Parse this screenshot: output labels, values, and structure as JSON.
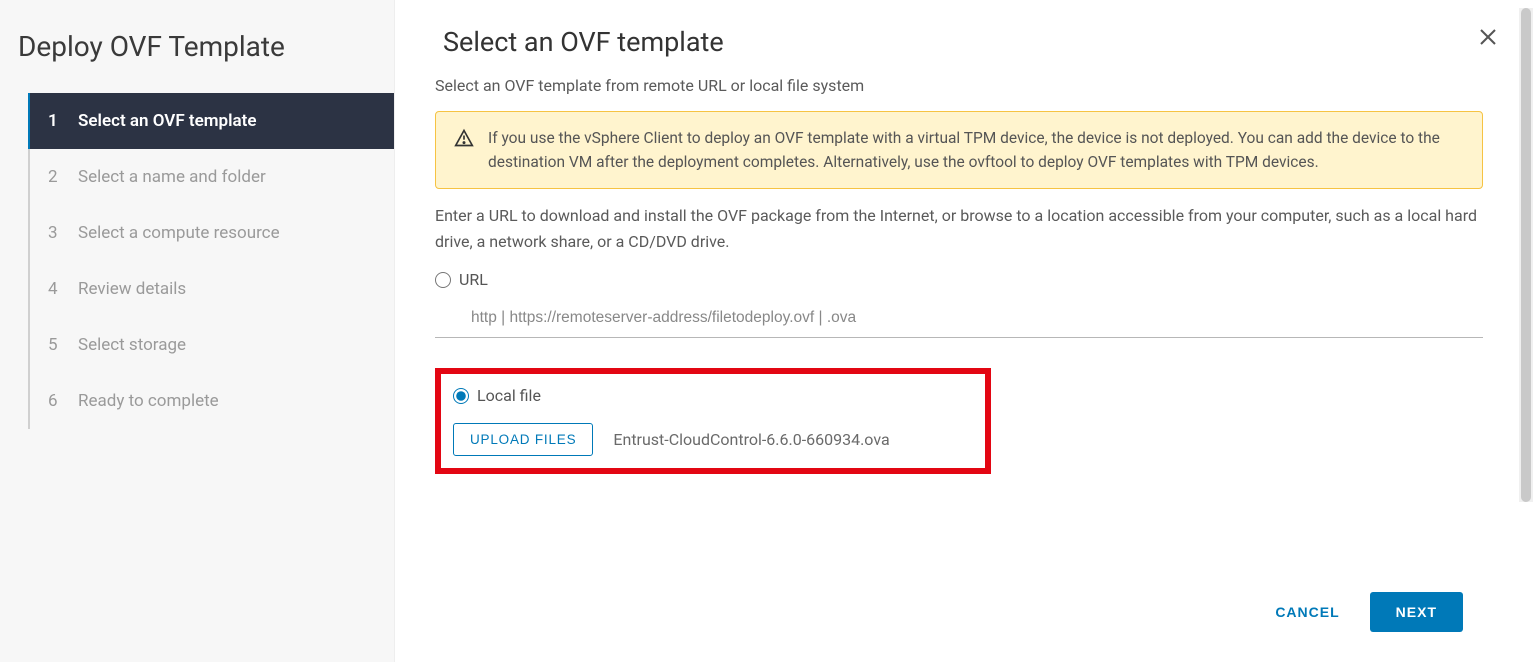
{
  "sidebar": {
    "title": "Deploy OVF Template",
    "steps": [
      {
        "num": "1",
        "label": "Select an OVF template",
        "active": true
      },
      {
        "num": "2",
        "label": "Select a name and folder",
        "active": false
      },
      {
        "num": "3",
        "label": "Select a compute resource",
        "active": false
      },
      {
        "num": "4",
        "label": "Review details",
        "active": false
      },
      {
        "num": "5",
        "label": "Select storage",
        "active": false
      },
      {
        "num": "6",
        "label": "Ready to complete",
        "active": false
      }
    ]
  },
  "main": {
    "title": "Select an OVF template",
    "subtitle": "Select an OVF template from remote URL or local file system",
    "alert": "If you use the vSphere Client to deploy an OVF template with a virtual TPM device, the device is not deployed. You can add the device to the destination VM after the deployment completes. Alternatively, use the ovftool to deploy OVF templates with TPM devices.",
    "desc": "Enter a URL to download and install the OVF package from the Internet, or browse to a location accessible from your computer, such as a local hard drive, a network share, or a CD/DVD drive.",
    "options": {
      "url_label": "URL",
      "url_placeholder": "http | https://remoteserver-address/filetodeploy.ovf | .ova",
      "local_label": "Local file",
      "upload_button": "UPLOAD FILES",
      "filename": "Entrust-CloudControl-6.6.0-660934.ova",
      "selected": "local"
    }
  },
  "footer": {
    "cancel": "CANCEL",
    "next": "NEXT"
  }
}
